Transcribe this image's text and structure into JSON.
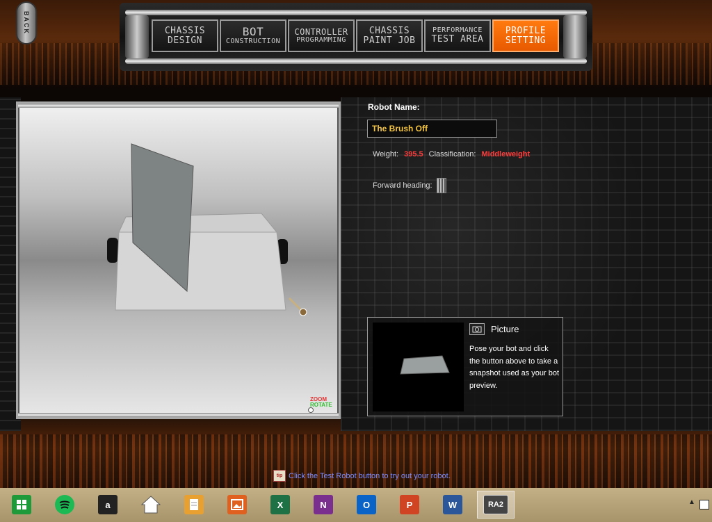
{
  "back_button": {
    "label": "BACK"
  },
  "nav": {
    "tabs": [
      {
        "line1": "CHASSIS",
        "line2": "DESIGN",
        "active": false
      },
      {
        "line1": "BOT",
        "line2": "CONSTRUCTION",
        "active": false
      },
      {
        "line1": "CONTROLLER",
        "line2": "PROGRAMMING",
        "active": false
      },
      {
        "line1": "CHASSIS",
        "line2": "PAINT JOB",
        "active": false
      },
      {
        "line1": "PERFORMANCE",
        "line2": "TEST AREA",
        "active": false
      },
      {
        "line1": "PROFILE",
        "line2": "SETTING",
        "active": true
      }
    ]
  },
  "viewport": {
    "zoom_label": "ZOOM",
    "rotate_label": "ROTATE"
  },
  "profile": {
    "robot_name_label": "Robot Name:",
    "robot_name_value": "The Brush Off",
    "weight_label": "Weight:",
    "weight_value": "395.5",
    "classification_label": "Classification:",
    "classification_value": "Middleweight",
    "forward_heading_label": "Forward heading:"
  },
  "picture": {
    "title": "Picture",
    "description": "Pose your bot and click the button above to take a snapshot used as your bot preview."
  },
  "status": {
    "badge": "tip",
    "text": "Click the Test Robot button to try out your robot."
  },
  "taskbar": {
    "items": [
      {
        "name": "store-icon",
        "glyph": "",
        "color": "#1e9a3a"
      },
      {
        "name": "spotify-icon",
        "glyph": "",
        "color": "#1db954"
      },
      {
        "name": "amazon-icon",
        "glyph": "a",
        "color": "#222222"
      },
      {
        "name": "home-icon",
        "glyph": "",
        "color": "#ffffff"
      },
      {
        "name": "files-icon",
        "glyph": "",
        "color": "#e8a030"
      },
      {
        "name": "photos-icon",
        "glyph": "",
        "color": "#e06020"
      },
      {
        "name": "excel-icon",
        "glyph": "X",
        "color": "#1e7145"
      },
      {
        "name": "onenote-icon",
        "glyph": "N",
        "color": "#7a2e8e"
      },
      {
        "name": "outlook-icon",
        "glyph": "O",
        "color": "#0a64c8"
      },
      {
        "name": "powerpoint-icon",
        "glyph": "P",
        "color": "#d04423"
      },
      {
        "name": "word-icon",
        "glyph": "W",
        "color": "#2b579a"
      },
      {
        "name": "ra2-icon",
        "glyph": "RA2",
        "color": "#444444"
      }
    ]
  }
}
